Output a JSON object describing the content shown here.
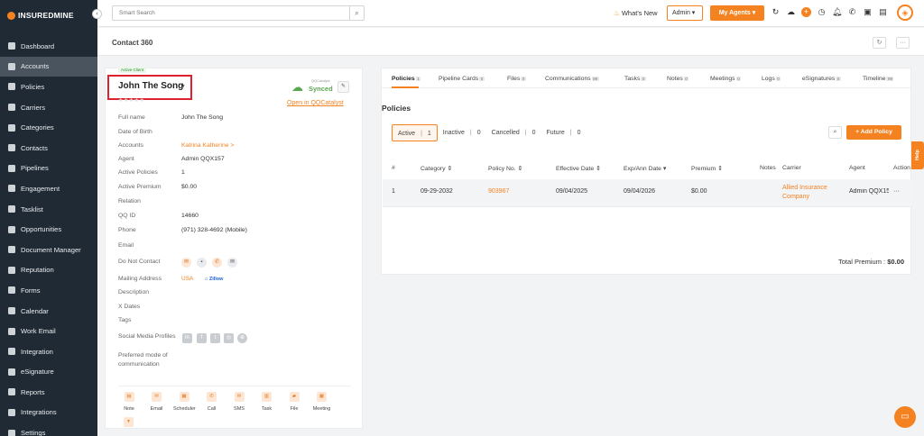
{
  "app": {
    "logo_text": "INSUREDMINE"
  },
  "sidebar": {
    "items": [
      {
        "label": "Dashboard",
        "icon": "dashboard-icon"
      },
      {
        "label": "Accounts",
        "icon": "accounts-icon",
        "active": true
      },
      {
        "label": "Policies",
        "icon": "policies-icon"
      },
      {
        "label": "Carriers",
        "icon": "carriers-icon"
      },
      {
        "label": "Categories",
        "icon": "categories-icon"
      },
      {
        "label": "Contacts",
        "icon": "contacts-icon"
      },
      {
        "label": "Pipelines",
        "icon": "pipelines-icon"
      },
      {
        "label": "Engagement",
        "icon": "engagement-icon"
      },
      {
        "label": "Tasklist",
        "icon": "tasklist-icon"
      },
      {
        "label": "Opportunities",
        "icon": "opportunities-icon"
      },
      {
        "label": "Document Manager",
        "icon": "document-manager-icon"
      },
      {
        "label": "Reputation",
        "icon": "reputation-icon"
      },
      {
        "label": "Forms",
        "icon": "forms-icon"
      },
      {
        "label": "Calendar",
        "icon": "calendar-icon"
      },
      {
        "label": "Work Email",
        "icon": "work-email-icon"
      },
      {
        "label": "Integration",
        "icon": "integration-icon"
      },
      {
        "label": "eSignature",
        "icon": "esignature-icon"
      },
      {
        "label": "Reports",
        "icon": "reports-icon"
      },
      {
        "label": "Integrations",
        "icon": "integrations-icon"
      },
      {
        "label": "Settings",
        "icon": "settings-icon"
      }
    ]
  },
  "topbar": {
    "search_placeholder": "Smart Search",
    "whats_new": "What's New",
    "admin_select": "Admin",
    "my_agents": "My Agents"
  },
  "page": {
    "title": "Contact 360"
  },
  "contact": {
    "status_badge": "Active Client",
    "name": "John The Song",
    "sync_sub": "QQCatalyst",
    "sync_status": "Synced",
    "open_link": "Open in QQCatalyst",
    "fields": [
      {
        "label": "Full name",
        "value": "John The Song"
      },
      {
        "label": "Date of Birth",
        "value": ""
      },
      {
        "label": "Accounts",
        "value": "Katrina Katherine >",
        "link": true
      },
      {
        "label": "Agent",
        "value": "Admin QQX157"
      },
      {
        "label": "Active Policies",
        "value": "1"
      },
      {
        "label": "Active Premium",
        "value": "$0.00"
      },
      {
        "label": "Relation",
        "value": ""
      },
      {
        "label": "QQ ID",
        "value": "14660"
      },
      {
        "label": "Phone",
        "value": "(971) 328-4692 (Mobile)"
      },
      {
        "label": "Email",
        "value": ""
      },
      {
        "label": "Do Not Contact",
        "value": ""
      },
      {
        "label": "Mailing Address",
        "value": ""
      },
      {
        "label": "Description",
        "value": ""
      },
      {
        "label": "X Dates",
        "value": ""
      },
      {
        "label": "Tags",
        "value": ""
      },
      {
        "label": "Social Media Profiles",
        "value": ""
      }
    ],
    "mailing_country": "USA",
    "zillow": "Zillow",
    "preferred_mode_label": "Preferred mode of communication",
    "actions": [
      "Note",
      "Email",
      "Scheduler",
      "Call",
      "SMS",
      "Task",
      "File",
      "Meeting"
    ]
  },
  "tabs": [
    {
      "label": "Policies",
      "count": "1"
    },
    {
      "label": "Pipeline Cards",
      "count": "0"
    },
    {
      "label": "Files",
      "count": "0"
    },
    {
      "label": "Communications",
      "count": "99"
    },
    {
      "label": "Tasks",
      "count": "0"
    },
    {
      "label": "Notes",
      "count": "0"
    },
    {
      "label": "Meetings",
      "count": "0"
    },
    {
      "label": "Logs",
      "count": "0"
    },
    {
      "label": "eSignatures",
      "count": "0"
    },
    {
      "label": "Timeline",
      "count": "99"
    }
  ],
  "policies": {
    "section_title": "Policies",
    "filters": [
      {
        "label": "Active",
        "count": "1"
      },
      {
        "label": "Inactive",
        "count": "0"
      },
      {
        "label": "Cancelled",
        "count": "0"
      },
      {
        "label": "Future",
        "count": "0"
      }
    ],
    "add_button": "+ Add Policy",
    "columns": [
      "#",
      "Category",
      "Policy No.",
      "Effective Date",
      "Exp/Ann Date",
      "Premium",
      "Notes",
      "Carrier",
      "Agent",
      "Action"
    ],
    "rows": [
      {
        "num": "1",
        "category": "09-29-2032",
        "policy_no": "903967",
        "effective": "09/04/2025",
        "expiry": "09/04/2026",
        "premium": "$0.00",
        "notes": "",
        "carrier": "Allied Insurance Company",
        "agent": "Admin QQX157",
        "action": "···"
      }
    ],
    "total_label": "Total Premium :",
    "total_value": "$0.00"
  },
  "help_label": "Help",
  "colors": {
    "accent": "#f58220",
    "sidebar": "#1f2a35",
    "highlight_box": "#e0202c"
  }
}
